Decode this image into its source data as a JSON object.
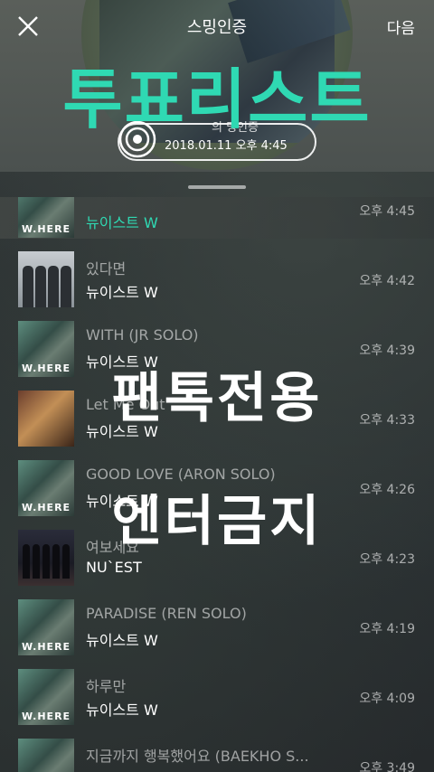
{
  "header": {
    "title": "스밍인증",
    "next_label": "다음",
    "banner": "투표리스트",
    "cert_label": "의 밍인증",
    "cert_date": "2018.01.11 오후 4:45"
  },
  "overlay": {
    "line1": "팬톡전용",
    "line2": "엔터금지"
  },
  "songs": [
    {
      "title": "",
      "artist": "뉴이스트 W",
      "time": "오후 4:45",
      "art": "w",
      "active": true
    },
    {
      "title": "있다면",
      "artist": "뉴이스트 W",
      "time": "오후 4:42",
      "art": "b"
    },
    {
      "title": "WITH (JR SOLO)",
      "artist": "뉴이스트 W",
      "time": "오후 4:39",
      "art": "w"
    },
    {
      "title": "Let Me Out",
      "artist": "뉴이스트 W",
      "time": "오후 4:33",
      "art": "r"
    },
    {
      "title": "GOOD LOVE (ARON SOLO)",
      "artist": "뉴이스트 W",
      "time": "오후 4:26",
      "art": "w"
    },
    {
      "title": "여보세요",
      "artist": "NU`EST",
      "time": "오후 4:23",
      "art": "k"
    },
    {
      "title": "PARADISE (REN SOLO)",
      "artist": "뉴이스트 W",
      "time": "오후 4:19",
      "art": "w"
    },
    {
      "title": "하루만",
      "artist": "뉴이스트 W",
      "time": "오후 4:09",
      "art": "w"
    },
    {
      "title": "지금까지 행복했어요 (BAEKHO S...",
      "artist": "뉴이스트 W",
      "time": "오후 3:49",
      "art": "w"
    }
  ],
  "colors": {
    "accent": "#2fd9b3",
    "background": "#2a2f31"
  }
}
